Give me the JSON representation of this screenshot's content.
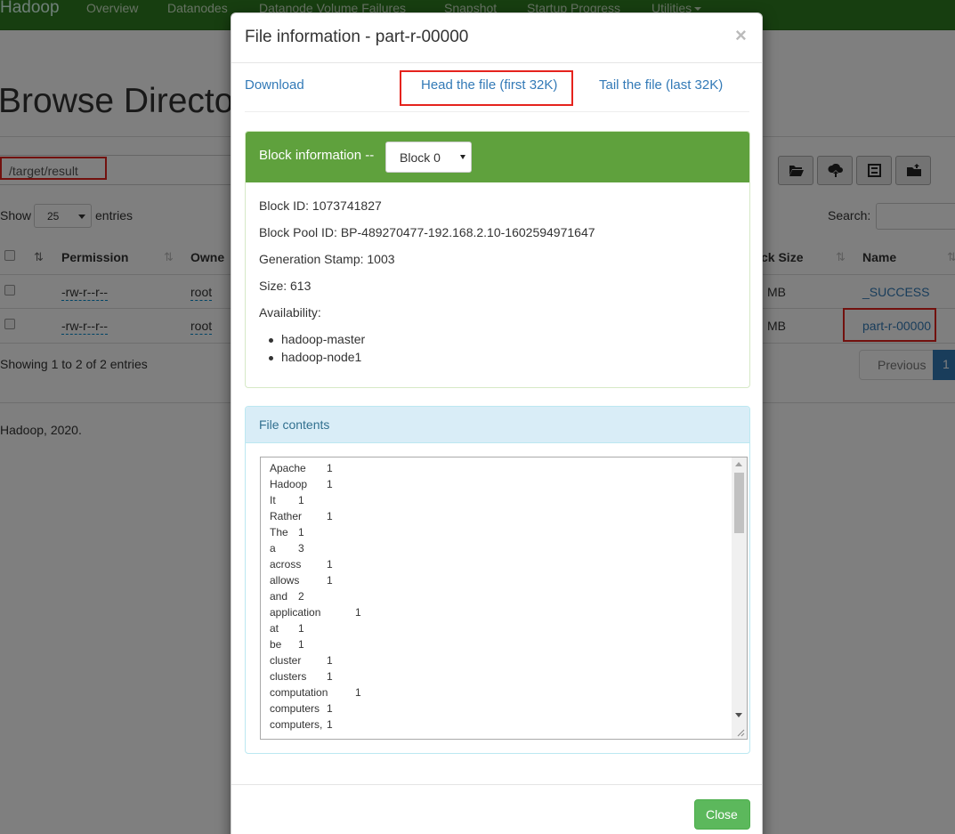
{
  "navbar": {
    "brand": "Hadoop",
    "items": [
      "Overview",
      "Datanodes",
      "Datanode Volume Failures",
      "Snapshot",
      "Startup Progress",
      "Utilities"
    ]
  },
  "page": {
    "title": "Browse Directo",
    "path": "/target/result",
    "show_label": "Show",
    "page_size": "25",
    "entries_label": "entries",
    "search_label": "Search:",
    "columns": {
      "permission": "Permission",
      "owner": "Owne",
      "block_size": "ck Size",
      "name": "Name"
    },
    "rows": [
      {
        "permission": "-rw-r--r--",
        "owner": "root",
        "block_size": "MB",
        "name": "_SUCCESS"
      },
      {
        "permission": "-rw-r--r--",
        "owner": "root",
        "block_size": "MB",
        "name": "part-r-00000"
      }
    ],
    "showing": "Showing 1 to 2 of 2 entries",
    "pager": {
      "previous": "Previous",
      "current": "1"
    },
    "footer": "Hadoop, 2020."
  },
  "modal": {
    "title": "File information - part-r-00000",
    "close_symbol": "×",
    "links": {
      "download": "Download",
      "head": "Head the file (first 32K)",
      "tail": "Tail the file (last 32K)"
    },
    "block_panel": {
      "heading": "Block information --",
      "selected_block": "Block 0",
      "block_id": "Block ID: 1073741827",
      "pool_id": "Block Pool ID: BP-489270477-192.168.2.10-1602594971647",
      "generation_stamp": "Generation Stamp: 1003",
      "size": "Size: 613",
      "availability_label": "Availability:",
      "availability": [
        "hadoop-master",
        "hadoop-node1"
      ]
    },
    "contents_panel": {
      "heading": "File contents",
      "lines": [
        {
          "word": "Apache",
          "count": "1"
        },
        {
          "word": "Hadoop",
          "count": "1"
        },
        {
          "word": "It",
          "count": "1"
        },
        {
          "word": "Rather",
          "count": "1"
        },
        {
          "word": "The",
          "count": "1"
        },
        {
          "word": "a",
          "count": "3"
        },
        {
          "word": "across",
          "count": "1"
        },
        {
          "word": "allows",
          "count": "1"
        },
        {
          "word": "and",
          "count": "2"
        },
        {
          "word": "application",
          "count": "1"
        },
        {
          "word": "at",
          "count": "1"
        },
        {
          "word": "be",
          "count": "1"
        },
        {
          "word": "cluster",
          "count": "1"
        },
        {
          "word": "clusters",
          "count": "1"
        },
        {
          "word": "computation",
          "count": "1"
        },
        {
          "word": "computers",
          "count": "1"
        },
        {
          "word": "computers,",
          "count": "1"
        }
      ]
    },
    "close_button": "Close"
  },
  "colors": {
    "navbar": "#2f7d20",
    "block_panel_header": "#5fa13d",
    "info_panel_header": "#d9edf7",
    "link": "#337ab7",
    "highlight_box": "#e5231d",
    "close_button": "#5cb85c"
  },
  "icons": [
    "folder-open-icon",
    "cloud-upload-icon",
    "list-icon",
    "create-folder-icon",
    "sort-icon",
    "close-icon",
    "caret-down-icon"
  ]
}
